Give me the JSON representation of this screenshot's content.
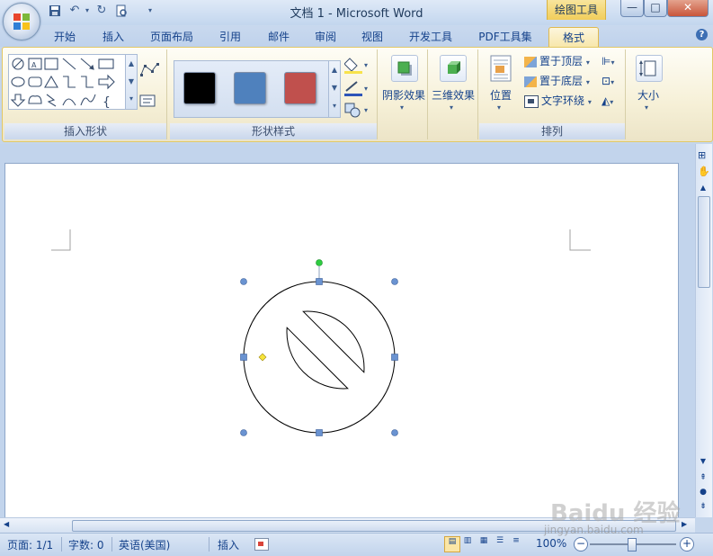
{
  "window": {
    "title": "文档 1 - Microsoft Word",
    "contextual_tab_group": "绘图工具",
    "minimize": "—",
    "maximize": "□",
    "close": "✕"
  },
  "tabs": [
    {
      "label": "开始"
    },
    {
      "label": "插入"
    },
    {
      "label": "页面布局"
    },
    {
      "label": "引用"
    },
    {
      "label": "邮件"
    },
    {
      "label": "审阅"
    },
    {
      "label": "视图"
    },
    {
      "label": "开发工具"
    },
    {
      "label": "PDF工具集"
    },
    {
      "label": "格式",
      "active": true
    }
  ],
  "help_label": "?",
  "ribbon": {
    "insert_shapes": {
      "label": "插入形状"
    },
    "shape_styles": {
      "label": "形状样式",
      "swatches": [
        "#000000",
        "#4f81bd",
        "#c0504d"
      ]
    },
    "shadow_effects": {
      "label": "阴影效果"
    },
    "3d_effects": {
      "label": "三维效果"
    },
    "arrange": {
      "label": "排列",
      "position": "位置",
      "bring_to_front": "置于顶层",
      "send_to_back": "置于底层",
      "text_wrapping": "文字环绕"
    },
    "size": {
      "label": "大小"
    }
  },
  "status_bar": {
    "page": "页面: 1/1",
    "word_count": "字数: 0",
    "language": "英语(美国)",
    "insert_mode": "插入",
    "zoom": "100%"
  },
  "watermark": {
    "main": "Baidu 经验",
    "sub": "jingyan.baidu.com"
  },
  "colors": {
    "handle_blue": "#6a93d1",
    "rotate_handle": "#2ecc40",
    "adjust_handle": "#f7e43c",
    "contextual_tab": "#f1cd5b"
  }
}
